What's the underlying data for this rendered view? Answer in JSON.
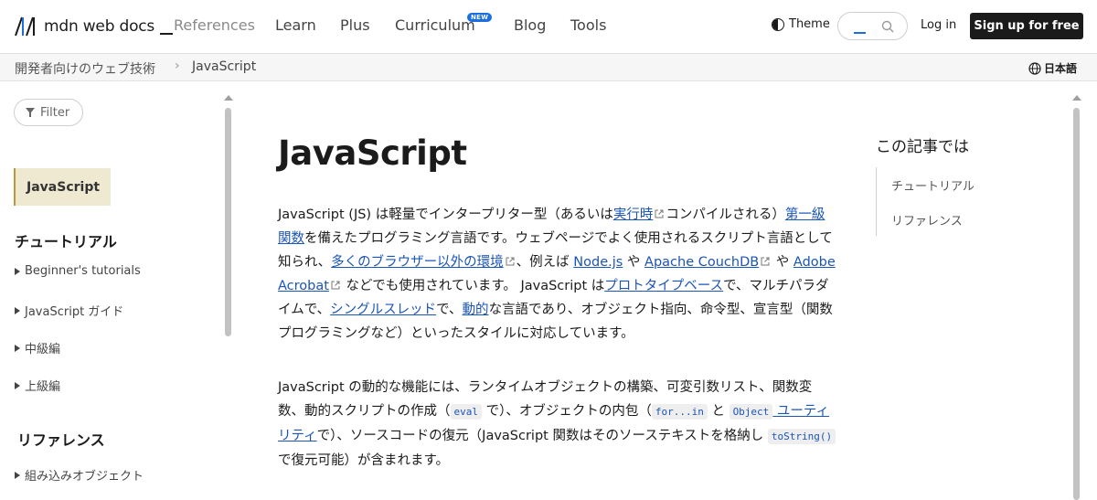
{
  "header": {
    "logo_text": "mdn web docs",
    "nav": [
      "References",
      "Learn",
      "Plus",
      "Curriculum",
      "Blog",
      "Tools"
    ],
    "new_badge": "NEW",
    "theme_label": "Theme",
    "login_label": "Log in",
    "signup_label": "Sign up for free"
  },
  "breadcrumb": {
    "parent": "開発者向けのウェブ技術",
    "current": "JavaScript",
    "language": "日本語"
  },
  "sidebar": {
    "filter_label": "Filter",
    "active_item": "JavaScript",
    "heading_tutorial": "チュートリアル",
    "tutorial_items": [
      "Beginner's tutorials",
      "JavaScript ガイド",
      "中級編",
      "上級編"
    ],
    "heading_reference": "リファレンス",
    "reference_items": [
      "組み込みオブジェクト"
    ]
  },
  "main": {
    "title": "JavaScript",
    "p1": {
      "t1": "JavaScript (JS) は軽量でインタープリター型（あるいは",
      "link_runtime": "実行時",
      "t2": "コンパイルされる）",
      "link_firstclass": "第一級関数",
      "t3": "を備えたプログラミング言語です。ウェブページでよく使用されるスクリプト言語として知られ、",
      "link_nonbrowser": "多くのブラウザー以外の環境",
      "t4": "、例えば ",
      "link_node": "Node.js",
      "t5": " や ",
      "link_couch": "Apache CouchDB",
      "t6": " や ",
      "link_acrobat": "Adobe Acrobat",
      "t7": " などでも使用されています。 JavaScript は",
      "link_proto": "プロトタイプベース",
      "t8": "で、マルチパラダイムで、",
      "link_single": "シングルスレッド",
      "t9": "で、",
      "link_dynamic": "動的",
      "t10": "な言語であり、オブジェクト指向、命令型、宣言型（関数プログラミングなど）といったスタイルに対応しています。"
    },
    "p2": {
      "t1": "JavaScript の動的な機能には、ランタイムオブジェクトの構築、可変引数リスト、関数変数、動的スクリプトの作成（",
      "code_eval": "eval",
      "t2": " で）、オブジェクトの内包（",
      "code_forin": "for...in",
      "t3": " と ",
      "code_object": "Object",
      "link_util": " ユーティリティ",
      "t4": "で）、ソースコードの復元（JavaScript 関数はそのソーステキストを格納し ",
      "code_tostring": "toString()",
      "t5": " で復元可能）が含まれます。"
    }
  },
  "toc": {
    "title": "この記事では",
    "items": [
      "チュートリアル",
      "リファレンス"
    ]
  },
  "colors": {
    "link": "#1a55b8",
    "accent_badge": "#1a6ee0",
    "active_bg": "#efe9d2"
  }
}
